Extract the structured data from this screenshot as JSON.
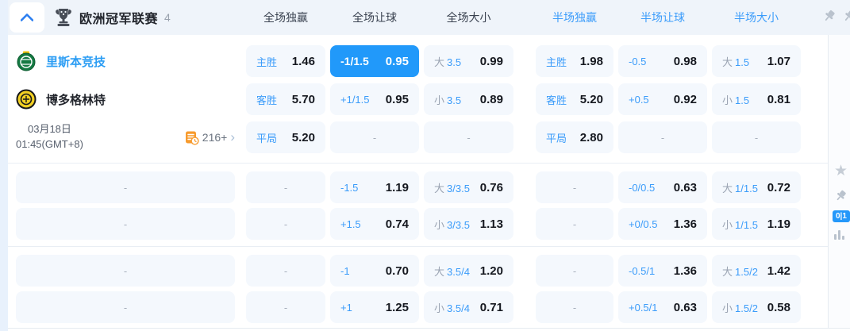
{
  "header": {
    "league": "欧洲冠军联赛",
    "count": "4",
    "columns": [
      {
        "label": "全场独赢",
        "tone": "full"
      },
      {
        "label": "全场让球",
        "tone": "full"
      },
      {
        "label": "全场大小",
        "tone": "full"
      },
      {
        "label": "半场独赢",
        "tone": "half"
      },
      {
        "label": "半场让球",
        "tone": "half"
      },
      {
        "label": "半场大小",
        "tone": "half"
      }
    ]
  },
  "match": {
    "home": "里斯本竞技",
    "away": "博多格林特",
    "date_line1": "03月18日",
    "date_line2": "01:45(GMT+8)",
    "markets_count": "216+"
  },
  "rail": {
    "badge": "0|1"
  },
  "colors": {
    "accent_blue": "#2199fa",
    "text_blue": "#3b9cfa",
    "cell_bg": "#f4f8fd",
    "header_bg": "#eff4fa",
    "orange": "#f79b2e"
  },
  "odds": {
    "blocks": [
      {
        "rows": [
          0,
          1,
          2
        ]
      },
      {
        "rows": [
          3,
          4
        ]
      },
      {
        "rows": [
          5,
          6
        ]
      }
    ],
    "rows": [
      [
        {
          "t": "odds",
          "l": "主胜",
          "v": "1.46"
        },
        {
          "t": "odds",
          "l": "-1/1.5",
          "v": "0.95",
          "sel": true
        },
        {
          "t": "ou",
          "p": "大",
          "ln": "3.5",
          "v": "0.99"
        },
        {
          "t": "odds",
          "l": "主胜",
          "v": "1.98"
        },
        {
          "t": "odds",
          "l": "-0.5",
          "v": "0.98"
        },
        {
          "t": "ou",
          "p": "大",
          "ln": "1.5",
          "v": "1.07"
        }
      ],
      [
        {
          "t": "odds",
          "l": "客胜",
          "v": "5.70"
        },
        {
          "t": "odds",
          "l": "+1/1.5",
          "v": "0.95"
        },
        {
          "t": "ou",
          "p": "小",
          "ln": "3.5",
          "v": "0.89"
        },
        {
          "t": "odds",
          "l": "客胜",
          "v": "5.20"
        },
        {
          "t": "odds",
          "l": "+0.5",
          "v": "0.92"
        },
        {
          "t": "ou",
          "p": "小",
          "ln": "1.5",
          "v": "0.81"
        }
      ],
      [
        {
          "t": "odds",
          "l": "平局",
          "v": "5.20"
        },
        {
          "t": "dash"
        },
        {
          "t": "dash"
        },
        {
          "t": "odds",
          "l": "平局",
          "v": "2.80"
        },
        {
          "t": "dash"
        },
        {
          "t": "dash"
        }
      ],
      [
        {
          "t": "dash"
        },
        {
          "t": "odds",
          "l": "-1.5",
          "v": "1.19"
        },
        {
          "t": "ou",
          "p": "大",
          "ln": "3/3.5",
          "v": "0.76"
        },
        {
          "t": "dash"
        },
        {
          "t": "odds",
          "l": "-0/0.5",
          "v": "0.63"
        },
        {
          "t": "ou",
          "p": "大",
          "ln": "1/1.5",
          "v": "0.72"
        }
      ],
      [
        {
          "t": "dash"
        },
        {
          "t": "odds",
          "l": "+1.5",
          "v": "0.74"
        },
        {
          "t": "ou",
          "p": "小",
          "ln": "3/3.5",
          "v": "1.13"
        },
        {
          "t": "dash"
        },
        {
          "t": "odds",
          "l": "+0/0.5",
          "v": "1.36"
        },
        {
          "t": "ou",
          "p": "小",
          "ln": "1/1.5",
          "v": "1.19"
        }
      ],
      [
        {
          "t": "dash"
        },
        {
          "t": "odds",
          "l": "-1",
          "v": "0.70"
        },
        {
          "t": "ou",
          "p": "大",
          "ln": "3.5/4",
          "v": "1.20"
        },
        {
          "t": "dash"
        },
        {
          "t": "odds",
          "l": "-0.5/1",
          "v": "1.36"
        },
        {
          "t": "ou",
          "p": "大",
          "ln": "1.5/2",
          "v": "1.42"
        }
      ],
      [
        {
          "t": "dash"
        },
        {
          "t": "odds",
          "l": "+1",
          "v": "1.25"
        },
        {
          "t": "ou",
          "p": "小",
          "ln": "3.5/4",
          "v": "0.71"
        },
        {
          "t": "dash"
        },
        {
          "t": "odds",
          "l": "+0.5/1",
          "v": "0.63"
        },
        {
          "t": "ou",
          "p": "小",
          "ln": "1.5/2",
          "v": "0.58"
        }
      ]
    ]
  }
}
